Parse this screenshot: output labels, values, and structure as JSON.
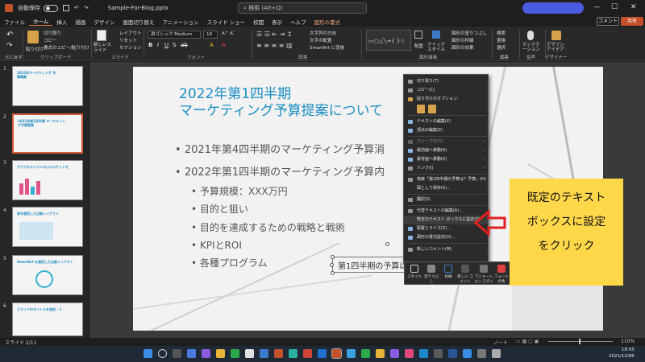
{
  "titlebar": {
    "autosave": "自動保存",
    "filename": "Sample-For-Blog.pptx",
    "search_placeholder": "検索 (Alt+Q)",
    "comment": "コメント",
    "share": "共有"
  },
  "tabs": [
    "ファイル",
    "ホーム",
    "挿入",
    "描画",
    "デザイン",
    "画面切り替え",
    "アニメーション",
    "スライド ショー",
    "校閲",
    "表示",
    "ヘルプ",
    "図形の書式"
  ],
  "ribbon": {
    "undo_label": "元に戻す",
    "clipboard_label": "クリップボード",
    "slides_label": "スライド",
    "font_label": "フォント",
    "paragraph_label": "段落",
    "drawing_label": "図形描画",
    "editing_label": "編集",
    "voice_label": "音声",
    "designer_label": "デザイナー",
    "paste": "貼り付け",
    "cut": "切り取り",
    "copy": "コピー",
    "format_painter": "書式のコピー/貼り付け",
    "new_slide": "新しいスライド",
    "layout": "レイアウト",
    "reset": "リセット",
    "section": "セクション",
    "font_name": "游ゴシック Medium",
    "font_size": "18",
    "text_direction": "文字列の方向",
    "align_text": "文字の配置",
    "smartart": "SmartArt に変換",
    "arrange": "配置",
    "quick_styles": "クイック スタイル",
    "shape_fill": "図形の塗りつぶし",
    "shape_outline": "図形の枠線",
    "shape_effects": "図形の効果",
    "find": "検索",
    "replace": "置換",
    "select": "選択",
    "dictate": "ディクテーション",
    "design_ideas": "デザイン アイデア"
  },
  "thumbs": [
    {
      "num": "1",
      "title": "2022年マーケティング 予算概要"
    },
    {
      "num": "2",
      "title": "2022年第1四半期 マーケティング予算提案"
    },
    {
      "num": "3",
      "title": "グラフもエンジンもいいロケットだ"
    },
    {
      "num": "4",
      "title": "表を使用した比較レイアウト"
    },
    {
      "num": "5",
      "title": "SmartArt を使用した比較レイアウト"
    },
    {
      "num": "6",
      "title": "スライドのタイトルを追加 - 1"
    }
  ],
  "slide": {
    "title_line1": "2022年第1四半期",
    "title_line2": "マーケティング予算提案について",
    "bullet1": "2021年第4四半期のマーケティング予算消",
    "bullet2": "2022年第1四半期のマーケティング予算内",
    "sub1": "予算規模：XXX万円",
    "sub2": "目的と狙い",
    "sub3": "目的を達成するための戦略と戦術",
    "sub4": "KPIとROI",
    "sub5": "各種プログラム",
    "textbox": "第1四半期の予算は？予算"
  },
  "context_menu": {
    "cut": "切り取り(T)",
    "copy": "コピー(C)",
    "paste_options": "貼り付けのオプション:",
    "edit_text": "テキストの編集(X)",
    "edit_points": "頂点の編集(E)",
    "group": "グループ化(G)",
    "bring_front": "最前面へ移動(R)",
    "send_back": "最背面へ移動(K)",
    "link": "リンク(I)",
    "search": "検索「第1四半期の予算は？予算」(H)",
    "save_as_picture": "図として保存(S)...",
    "translate": "翻訳(S)",
    "alt_text": "代替テキストの編集(A)...",
    "default_textbox": "既定のテキスト ボックスに設定(D)",
    "size_position": "配置とサイズ(Z)...",
    "format_shape": "図形の書式設定(O)...",
    "new_comment": "新しいコメント(M)"
  },
  "minibar": {
    "style": "スタイル",
    "fill": "塗りつぶし",
    "outline": "枠線",
    "new_comment": "新しい コメント",
    "animation": "アニメーション スタイル",
    "font_color": "フォントの色",
    "bring_front": "最前面へ 移動"
  },
  "callout": {
    "line1": "既定のテキスト",
    "line2": "ボックスに設定",
    "line3": "をクリック"
  },
  "status": {
    "slide": "スライド 2/11",
    "notes": "ノート",
    "zoom": "110%"
  },
  "clock": {
    "time": "18:55",
    "date": "2021/12/06"
  },
  "colors": {
    "accent": "#c4502c",
    "title_blue": "#1a8ec4",
    "callout": "#ffd84a",
    "arrow": "#e02020"
  }
}
